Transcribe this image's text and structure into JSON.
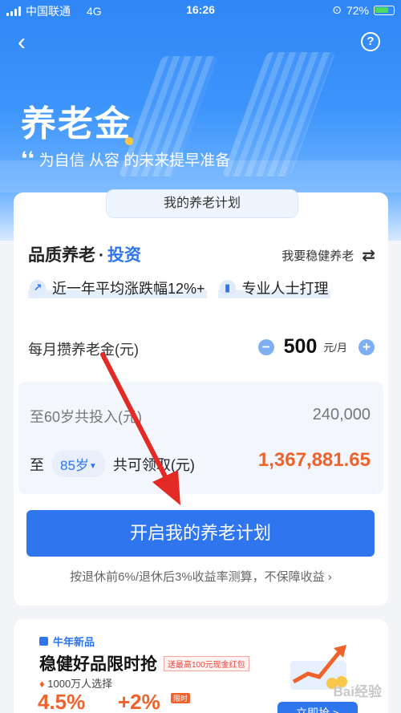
{
  "status_bar": {
    "carrier": "中国联通",
    "network": "4G",
    "time": "16:26",
    "battery": "72%"
  },
  "hero": {
    "title": "养老金",
    "subtitle": "为自信 从容 的未来提早准备"
  },
  "plan": {
    "tab_label": "我的养老计划",
    "title_main": "品质养老",
    "title_sep": "·",
    "title_accent": "投资",
    "switch_label": "我要稳健养老",
    "tags": [
      {
        "label": "近一年平均涨跌幅12%+",
        "icon": "trend-icon"
      },
      {
        "label": "专业人士打理",
        "icon": "thermometer-icon"
      }
    ],
    "monthly_label": "每月攒养老金(元)",
    "monthly_amount": "500",
    "monthly_unit": "元/月",
    "invest_label": "至60岁共投入(元)",
    "invest_value": "240,000",
    "receive_prefix": "至",
    "receive_age": "85岁",
    "receive_label": "共可领取(元)",
    "receive_value": "1,367,881.65",
    "cta_label": "开启我的养老计划",
    "note": "按退休前6%/退休后3%收益率测算，不保障收益"
  },
  "product": {
    "new_tag": "牛年新品",
    "title": "稳健好品限时抢",
    "red_tag": "送最高100元现金红包",
    "users": "1000万人选择",
    "rate1": "4.5%",
    "rate2": "+2%",
    "limited": "限时",
    "grab_label": "立即抢 >",
    "watermark": "Bai经验"
  },
  "colors": {
    "brand_blue": "#2f76ee",
    "highlight_orange": "#f0622b",
    "annotation_red": "#e32a25"
  }
}
